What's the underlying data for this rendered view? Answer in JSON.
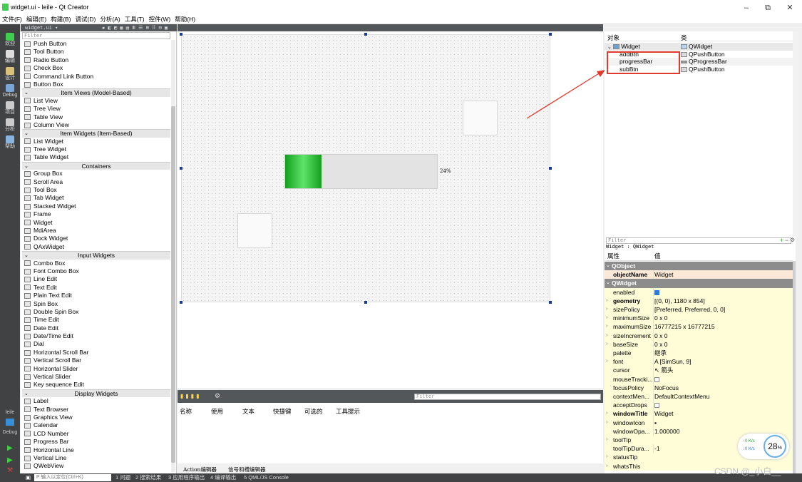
{
  "window": {
    "title": "widget.ui - leile - Qt Creator",
    "controls": [
      "–",
      "⧉",
      "✕"
    ]
  },
  "menu": [
    "文件(F)",
    "编辑(E)",
    "构建(B)",
    "调试(D)",
    "分析(A)",
    "工具(T)",
    "控件(W)",
    "帮助(H)"
  ],
  "modes": [
    {
      "label": "欢迎",
      "icon": "qt-welcome-icon",
      "color": "#41cd52"
    },
    {
      "label": "编辑",
      "icon": "edit-icon",
      "color": "#dddddd"
    },
    {
      "label": "设计",
      "icon": "design-icon",
      "color": "#d8c27a"
    },
    {
      "label": "Debug",
      "icon": "debug-icon",
      "color": "#7aa5d8"
    },
    {
      "label": "项目",
      "icon": "project-icon",
      "color": "#cccccc"
    },
    {
      "label": "分析",
      "icon": "analyze-icon",
      "color": "#cccccc"
    },
    {
      "label": "帮助",
      "icon": "help-icon",
      "color": "#8ab4e0"
    }
  ],
  "kit": {
    "project": "leile",
    "mode": "Debug"
  },
  "editor": {
    "file": "widget.ui",
    "toolbar_icons": "▪ ◧ ◩ ▦ ▤ Ⅲ ☰ ⊞ ⠿ ⊟ ▣"
  },
  "widget_box": {
    "filter_placeholder": "Filter",
    "groups": [
      {
        "name": null,
        "items": [
          "Push Button",
          "Tool Button",
          "Radio Button",
          "Check Box",
          "Command Link Button",
          "Button Box"
        ]
      },
      {
        "name": "Item Views (Model-Based)",
        "items": [
          "List View",
          "Tree View",
          "Table View",
          "Column View"
        ]
      },
      {
        "name": "Item Widgets (Item-Based)",
        "items": [
          "List Widget",
          "Tree Widget",
          "Table Widget"
        ]
      },
      {
        "name": "Containers",
        "items": [
          "Group Box",
          "Scroll Area",
          "Tool Box",
          "Tab Widget",
          "Stacked Widget",
          "Frame",
          "Widget",
          "MdiArea",
          "Dock Widget",
          "QAxWidget"
        ]
      },
      {
        "name": "Input Widgets",
        "items": [
          "Combo Box",
          "Font Combo Box",
          "Line Edit",
          "Text Edit",
          "Plain Text Edit",
          "Spin Box",
          "Double Spin Box",
          "Time Edit",
          "Date Edit",
          "Date/Time Edit",
          "Dial",
          "Horizontal Scroll Bar",
          "Vertical Scroll Bar",
          "Horizontal Slider",
          "Vertical Slider",
          "Key sequence Edit"
        ]
      },
      {
        "name": "Display Widgets",
        "items": [
          "Label",
          "Text Browser",
          "Graphics View",
          "Calendar",
          "LCD Number",
          "Progress Bar",
          "Horizontal Line",
          "Vertical Line",
          "QWebView"
        ]
      }
    ]
  },
  "form": {
    "progress_value": 0.24,
    "progress_text": "24%"
  },
  "object_inspector": {
    "headers": [
      "对象",
      "类"
    ],
    "root": {
      "name": "Widget",
      "class": "QWidget"
    },
    "children": [
      {
        "name": "addBtn",
        "class": "QPushButton"
      },
      {
        "name": "progressBar",
        "class": "QProgressBar"
      },
      {
        "name": "subBtn",
        "class": "QPushButton"
      }
    ],
    "highlight_color": "#e13b30"
  },
  "property_editor": {
    "filter_placeholder": "Filter",
    "context": "Widget : QWidget",
    "headers": [
      "属性",
      "值"
    ],
    "rows": [
      {
        "type": "cat",
        "name": "QObject"
      },
      {
        "type": "prop",
        "name": "objectName",
        "value": "Widget",
        "bold": true,
        "bg": "#fbe8d6"
      },
      {
        "type": "cat",
        "name": "QWidget"
      },
      {
        "type": "prop",
        "name": "enabled",
        "value": "",
        "check": "on"
      },
      {
        "type": "prop",
        "name": "geometry",
        "value": "[(0, 0), 1180 x 854]",
        "bold": true,
        "exp": true
      },
      {
        "type": "prop",
        "name": "sizePolicy",
        "value": "[Preferred, Preferred, 0, 0]",
        "exp": true
      },
      {
        "type": "prop",
        "name": "minimumSize",
        "value": "0 x 0",
        "exp": true
      },
      {
        "type": "prop",
        "name": "maximumSize",
        "value": "16777215 x 16777215",
        "exp": true
      },
      {
        "type": "prop",
        "name": "sizeIncrement",
        "value": "0 x 0",
        "exp": true
      },
      {
        "type": "prop",
        "name": "baseSize",
        "value": "0 x 0",
        "exp": true
      },
      {
        "type": "prop",
        "name": "palette",
        "value": "继承"
      },
      {
        "type": "prop",
        "name": "font",
        "value": "A  [SimSun, 9]",
        "exp": true
      },
      {
        "type": "prop",
        "name": "cursor",
        "value": "↖ 箭头"
      },
      {
        "type": "prop",
        "name": "mouseTracki...",
        "value": "",
        "check": "off"
      },
      {
        "type": "prop",
        "name": "focusPolicy",
        "value": "NoFocus"
      },
      {
        "type": "prop",
        "name": "contextMen...",
        "value": "DefaultContextMenu"
      },
      {
        "type": "prop",
        "name": "acceptDrops",
        "value": "",
        "check": "off"
      },
      {
        "type": "prop",
        "name": "windowTitle",
        "value": "Widget",
        "bold": true,
        "exp": true
      },
      {
        "type": "prop",
        "name": "windowIcon",
        "value": "▪",
        "exp": true
      },
      {
        "type": "prop",
        "name": "windowOpa...",
        "value": "1.000000"
      },
      {
        "type": "prop",
        "name": "toolTip",
        "value": "",
        "exp": true
      },
      {
        "type": "prop",
        "name": "toolTipDura...",
        "value": "-1"
      },
      {
        "type": "prop",
        "name": "statusTip",
        "value": "",
        "exp": true
      },
      {
        "type": "prop",
        "name": "whatsThis",
        "value": "",
        "exp": true
      }
    ]
  },
  "action_editor": {
    "filter_placeholder": "Filter",
    "columns": [
      "名称",
      "使用",
      "文本",
      "快捷键",
      "可选的",
      "工具提示"
    ],
    "tabs": [
      "Action编辑器",
      "信号和槽编辑器"
    ]
  },
  "status_bar": {
    "locator_placeholder": "P 输入以定位(Ctrl+K)",
    "panes": [
      "1 问题",
      "2 搜索结果",
      "3 应用程序输出",
      "4 编译输出",
      "5 QML/JS Console"
    ]
  },
  "overlay": {
    "net_up": "↑0  K/s",
    "net_down": "↓0  K/s",
    "percent": "28",
    "percent_unit": "%",
    "watermark": "CSDN @_小白__"
  }
}
